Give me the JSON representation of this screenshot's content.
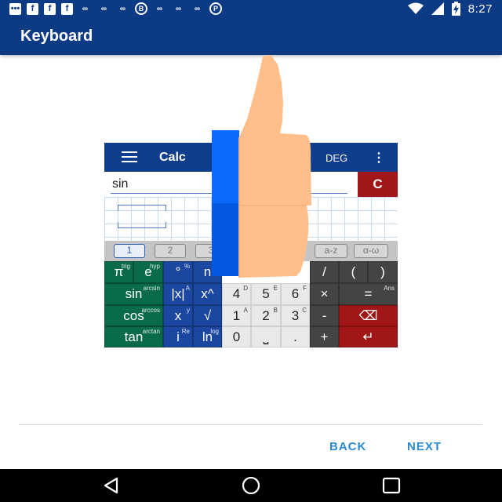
{
  "status_bar": {
    "time": "8:27",
    "left_icons": [
      "message-icon",
      "facebook-icon",
      "facebook-icon",
      "facebook-icon",
      "link-icon",
      "link-icon",
      "link-icon",
      "b-icon",
      "link-icon",
      "link-icon",
      "link-icon",
      "pinterest-icon"
    ],
    "right_icons": [
      "wifi-icon",
      "signal-icon",
      "battery-charging-icon"
    ]
  },
  "app_bar": {
    "title": "Keyboard"
  },
  "illustration": {
    "calc": {
      "title": "Calc",
      "angle_mode": "DEG",
      "input_text": "sin",
      "clear_label": "C",
      "tabs": [
        "1",
        "2",
        "3",
        "a-z",
        "α-ω"
      ],
      "keys": {
        "pi": "π",
        "pi_sub": "trig",
        "e": "e",
        "e_sub": "hyp",
        "deg": "°",
        "deg_sub": "%",
        "n": "n",
        "n_sub": "n",
        "sin": "sin",
        "sin_sub": "arcsin",
        "abs": "|x|",
        "abs_sub": "A",
        "pow": "x^",
        "pow_sub": "",
        "cos": "cos",
        "cos_sub": "arccos",
        "x": "x",
        "x_sub": "y",
        "sqrt": "√",
        "sqrt_sub": "",
        "tan": "tan",
        "tan_sub": "arctan",
        "i": "i",
        "i_sub": "Re",
        "ln": "ln",
        "ln_sub": "log",
        "d4": "4",
        "d4_sub": "D",
        "d5": "5",
        "d5_sub": "E",
        "d6": "6",
        "d6_sub": "F",
        "d1": "1",
        "d1_sub": "A",
        "d2": "2",
        "d2_sub": "B",
        "d3": "3",
        "d3_sub": "C",
        "d0": "0",
        "space": "⎵",
        "dot": ".",
        "div": "/",
        "lparen": "(",
        "rparen": ")",
        "mul": "×",
        "eq": "=",
        "eq_sub": "Ans",
        "minus": "-",
        "backspace": "⌫",
        "plus": "+",
        "enter": "↵"
      }
    }
  },
  "footer": {
    "back_label": "BACK",
    "next_label": "NEXT"
  },
  "colors": {
    "app_bar": "#0d3a85",
    "accent": "#2a8ad1",
    "red_key": "#a11717"
  }
}
